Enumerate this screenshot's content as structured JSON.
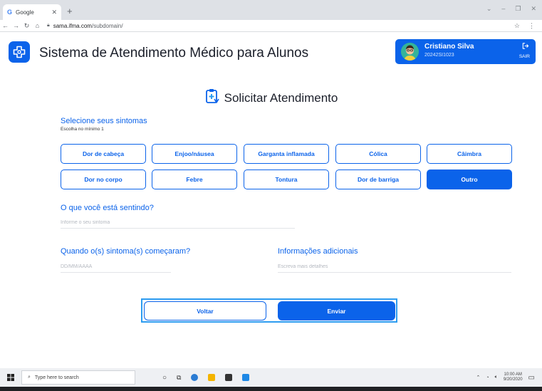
{
  "browser": {
    "tab_title": "Google",
    "url_host": "sama.ifma.com",
    "url_path": "/subdomain/"
  },
  "app": {
    "title": "Sistema de Atendimento Médico para Alunos"
  },
  "user": {
    "name": "Cristiano Silva",
    "id": "20242SI1023",
    "logout_label": "SAIR"
  },
  "form": {
    "title": "Solicitar Atendimento",
    "symptoms_label": "Selecione seus sintomas",
    "symptoms_hint": "Escolha no mínimo 1",
    "symptoms": [
      {
        "label": "Dor de cabeça",
        "selected": false
      },
      {
        "label": "Enjoo/náusea",
        "selected": false
      },
      {
        "label": "Garganta inflamada",
        "selected": false
      },
      {
        "label": "Cólica",
        "selected": false
      },
      {
        "label": "Câimbra",
        "selected": false
      },
      {
        "label": "Dor no corpo",
        "selected": false
      },
      {
        "label": "Febre",
        "selected": false
      },
      {
        "label": "Tontura",
        "selected": false
      },
      {
        "label": "Dor de barriga",
        "selected": false
      },
      {
        "label": "Outro",
        "selected": true
      }
    ],
    "feeling_label": "O que você está sentindo?",
    "feeling_placeholder": "Informe o seu sintoma",
    "start_label": "Quando o(s) sintoma(s) começaram?",
    "start_placeholder": "DD/MM/AAAA",
    "info_label": "Informações adicionais",
    "info_placeholder": "Escreva mais detalhes",
    "back_label": "Voltar",
    "send_label": "Enviar"
  },
  "taskbar": {
    "search_placeholder": "Type here to search",
    "time": "10:00 AM",
    "date": "9/20/2020"
  },
  "colors": {
    "primary": "#0b63ea",
    "selection_outline": "#2d9cf0"
  }
}
